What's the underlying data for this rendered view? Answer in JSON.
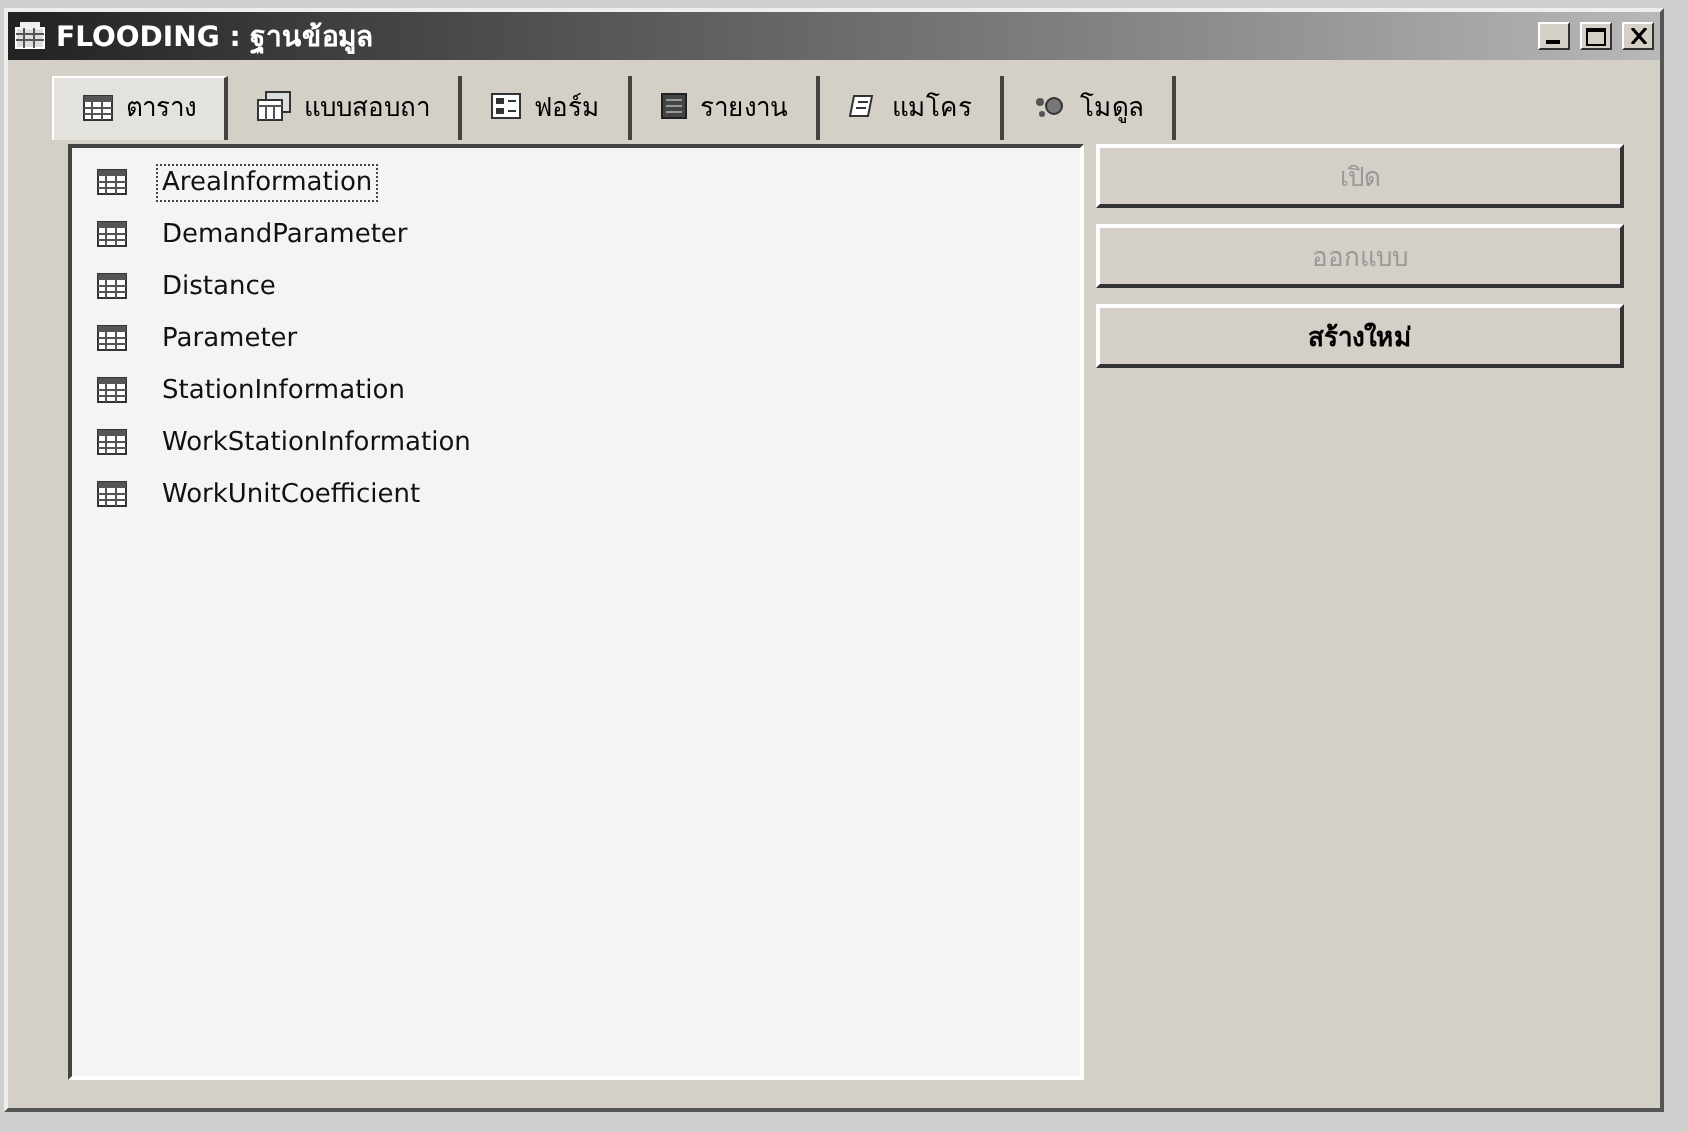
{
  "window": {
    "title": "FLOODING : ฐานข้อมูล"
  },
  "tabs": [
    {
      "label": "ตาราง",
      "kind": "table",
      "selected": true
    },
    {
      "label": "แบบสอบถา",
      "kind": "query",
      "selected": false
    },
    {
      "label": "ฟอร์ม",
      "kind": "form",
      "selected": false
    },
    {
      "label": "รายงาน",
      "kind": "report",
      "selected": false
    },
    {
      "label": "แมโคร",
      "kind": "macro",
      "selected": false
    },
    {
      "label": "โมดูล",
      "kind": "module",
      "selected": false
    }
  ],
  "objects": [
    {
      "name": "AreaInformation",
      "selected": true
    },
    {
      "name": "DemandParameter",
      "selected": false
    },
    {
      "name": "Distance",
      "selected": false
    },
    {
      "name": "Parameter",
      "selected": false
    },
    {
      "name": "StationInformation",
      "selected": false
    },
    {
      "name": "WorkStationInformation",
      "selected": false
    },
    {
      "name": "WorkUnitCoefficient",
      "selected": false
    }
  ],
  "buttons": [
    {
      "label": "เปิด",
      "disabled": true
    },
    {
      "label": "ออกแบบ",
      "disabled": true
    },
    {
      "label": "สร้างใหม่",
      "disabled": false
    }
  ]
}
